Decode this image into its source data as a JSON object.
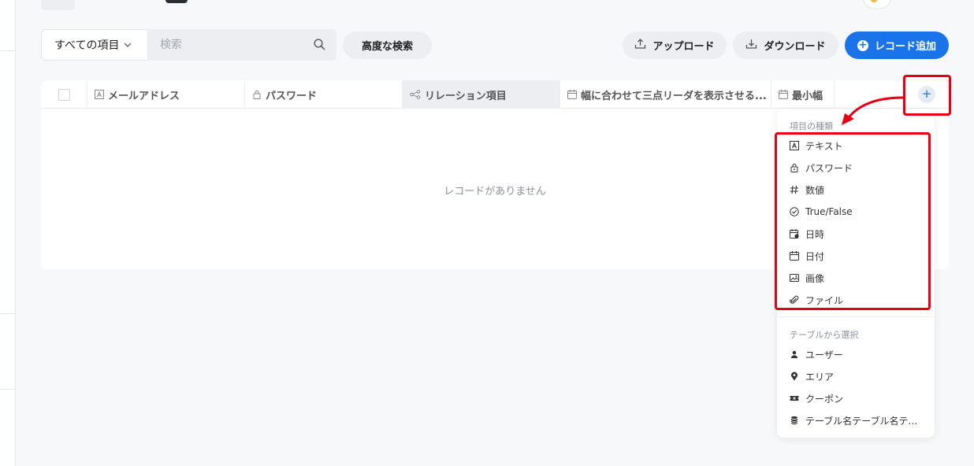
{
  "toolbar": {
    "filter_select": "すべての項目",
    "search_placeholder": "検索",
    "advanced_search": "高度な検索",
    "upload": "アップロード",
    "download": "ダウンロード",
    "add_record": "レコード追加"
  },
  "table": {
    "columns": [
      {
        "label": "メールアドレス",
        "icon": "text-type-icon"
      },
      {
        "label": "パスワード",
        "icon": "lock-icon"
      },
      {
        "label": "リレーション項目",
        "icon": "relation-icon"
      },
      {
        "label": "幅に合わせて三点リーダを表示させる...",
        "icon": "calendar-icon"
      },
      {
        "label": "最小幅",
        "icon": "calendar-icon"
      }
    ],
    "empty_message": "レコードがありません",
    "add_column_symbol": "+"
  },
  "menu": {
    "type_section_title": "項目の種類",
    "type_items": [
      {
        "label": "テキスト",
        "icon": "text-type-icon"
      },
      {
        "label": "パスワード",
        "icon": "lock-icon"
      },
      {
        "label": "数値",
        "icon": "hash-icon"
      },
      {
        "label": "True/False",
        "icon": "check-circle-icon"
      },
      {
        "label": "日時",
        "icon": "calendar-clock-icon"
      },
      {
        "label": "日付",
        "icon": "calendar-icon"
      },
      {
        "label": "画像",
        "icon": "image-icon"
      },
      {
        "label": "ファイル",
        "icon": "paperclip-icon"
      }
    ],
    "table_section_title": "テーブルから選択",
    "table_items": [
      {
        "label": "ユーザー",
        "icon": "person-icon"
      },
      {
        "label": "エリア",
        "icon": "location-pin-icon"
      },
      {
        "label": "クーポン",
        "icon": "ticket-icon"
      },
      {
        "label": "テーブル名テーブル名テ...",
        "icon": "database-icon"
      }
    ]
  },
  "colors": {
    "accent": "#1a73e8",
    "highlight_red": "#e60012",
    "background": "#f7f8fa"
  }
}
